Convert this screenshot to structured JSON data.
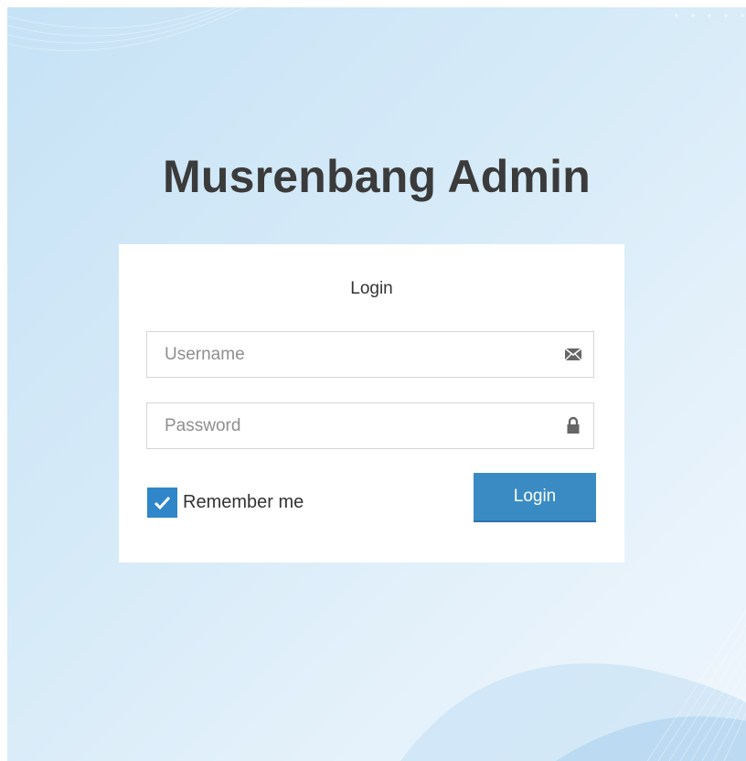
{
  "app": {
    "title": "Musrenbang Admin"
  },
  "login_form": {
    "heading": "Login",
    "username": {
      "value": "",
      "placeholder": "Username",
      "icon": "envelope-icon"
    },
    "password": {
      "value": "",
      "placeholder": "Password",
      "icon": "lock-icon"
    },
    "remember_me": {
      "label": "Remember me",
      "checked": true
    },
    "submit_label": "Login"
  },
  "colors": {
    "background_light": "#eef6fc",
    "background_dark": "#c6e2f6",
    "title_text": "#3b3b3b",
    "card_background": "#ffffff",
    "accent": "#3a8bc3",
    "checkbox": "#2f86c8"
  }
}
